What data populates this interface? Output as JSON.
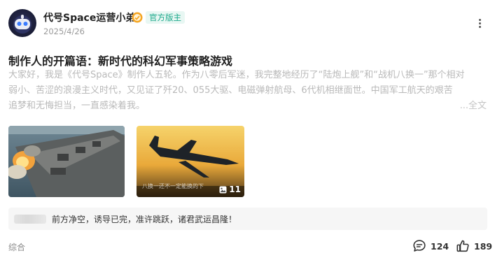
{
  "header": {
    "username": "代号Space运营小弟",
    "official_badge": "官方版主",
    "date": "2025/4/26"
  },
  "post": {
    "title": "制作人的开篇语：新时代的科幻军事策略游戏",
    "body_lines": [
      "大家好，我是《代号Space》制作人五轮。作为八零后军迷，我完整地经历了“陆炮上舰”和“战机八换一”那个相对",
      "弱小、苦涩的浪漫主义时代，又见证了歼20、055大驱、电磁弹射航母、6代机相继面世。中国军工航天的艰苦",
      "追梦和无悔担当，一直感染着我。"
    ],
    "read_full": "...全文",
    "image_caption": "八换一还不一定能换的下",
    "image_count": "11"
  },
  "comment_preview": {
    "text": "前方净空，诱导已完，准许跳跃，诸君武运昌隆！"
  },
  "footer": {
    "category": "综合",
    "comments_count": "124",
    "likes_count": "189"
  },
  "colors": {
    "badge_green": "#1aa88a",
    "muted_text": "#b9b9b9"
  }
}
